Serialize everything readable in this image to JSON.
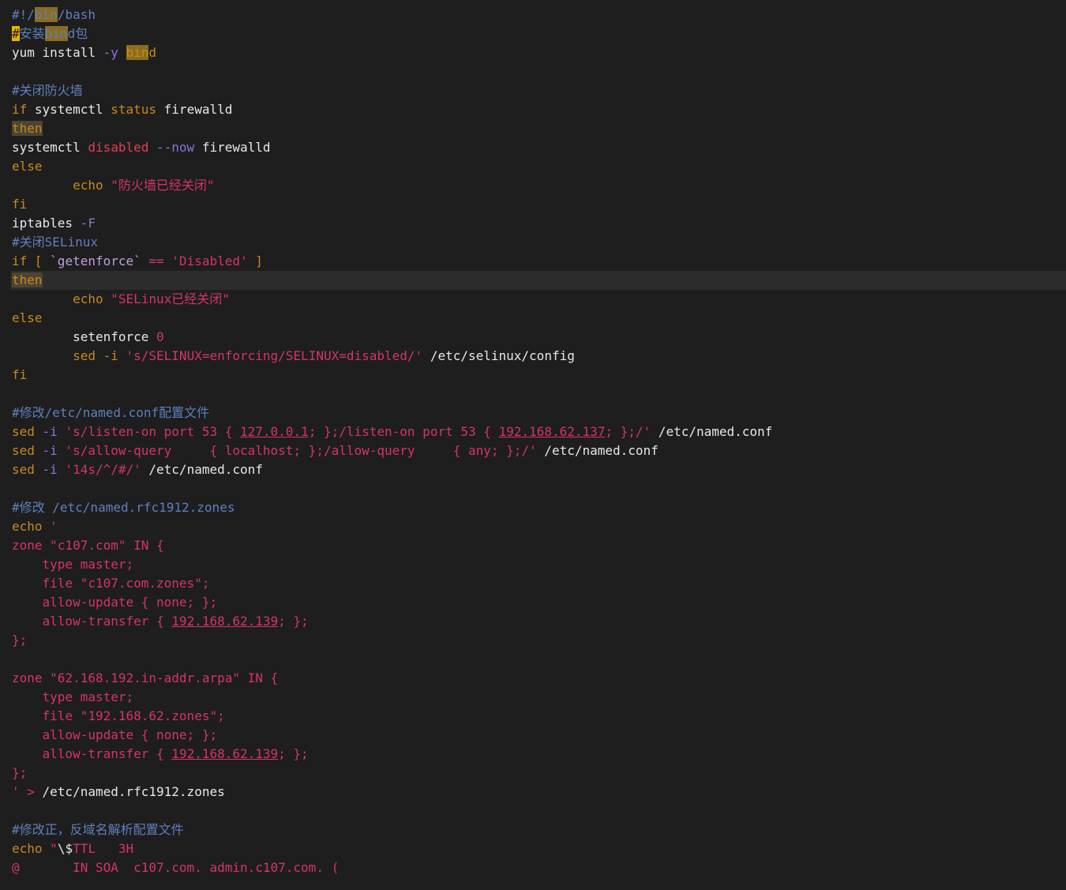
{
  "editor": {
    "current_line_index": 14,
    "colors": {
      "background": "#1e1e1e",
      "comment": "#5f7fbf",
      "keyword": "#c8891c",
      "string": "#d6336c",
      "search_highlight": "#8a6d1e"
    },
    "lines": [
      [
        {
          "t": "#!/",
          "c": "com"
        },
        {
          "t": "bin",
          "c": "com",
          "h": "hl"
        },
        {
          "t": "/bash",
          "c": "com"
        }
      ],
      [
        {
          "t": "#",
          "c": "com",
          "h": "cursor"
        },
        {
          "t": "安装",
          "c": "com"
        },
        {
          "t": "bin",
          "c": "com",
          "h": "hl"
        },
        {
          "t": "d包",
          "c": "com"
        }
      ],
      [
        {
          "t": "yum install ",
          "c": "cmd"
        },
        {
          "t": "-y",
          "c": "opt"
        },
        {
          "t": " ",
          "c": "cmd"
        },
        {
          "t": "bin",
          "c": "kw",
          "h": "hl"
        },
        {
          "t": "d",
          "c": "kw"
        }
      ],
      [],
      [
        {
          "t": "#关闭防火墙",
          "c": "com"
        }
      ],
      [
        {
          "t": "if",
          "c": "kw"
        },
        {
          "t": " systemctl ",
          "c": "cmd"
        },
        {
          "t": "status",
          "c": "kw"
        },
        {
          "t": " firewalld",
          "c": "cmd"
        }
      ],
      [
        {
          "t": "then",
          "c": "kw",
          "h": "hl2"
        }
      ],
      [
        {
          "t": "systemctl ",
          "c": "cmd"
        },
        {
          "t": "disabled",
          "c": "red"
        },
        {
          "t": " --now",
          "c": "opt"
        },
        {
          "t": " firewalld",
          "c": "cmd"
        }
      ],
      [
        {
          "t": "else",
          "c": "kw"
        }
      ],
      [
        {
          "t": "        echo ",
          "c": "kw"
        },
        {
          "t": "\"防火墙已经关闭\"",
          "c": "str"
        }
      ],
      [
        {
          "t": "fi",
          "c": "kw"
        }
      ],
      [
        {
          "t": "iptables ",
          "c": "cmd"
        },
        {
          "t": "-F",
          "c": "opt"
        }
      ],
      [
        {
          "t": "#关闭SELinux",
          "c": "com"
        }
      ],
      [
        {
          "t": "if [ ",
          "c": "kw"
        },
        {
          "t": "`getenforce`",
          "c": "cmdsub"
        },
        {
          "t": " == ",
          "c": "op"
        },
        {
          "t": "'Disabled'",
          "c": "str"
        },
        {
          "t": " ]",
          "c": "kw"
        }
      ],
      [
        {
          "t": "then",
          "c": "kw",
          "h": "hl2"
        }
      ],
      [
        {
          "t": "        echo ",
          "c": "kw"
        },
        {
          "t": "\"SELinux已经关闭\"",
          "c": "str"
        }
      ],
      [
        {
          "t": "else",
          "c": "kw"
        }
      ],
      [
        {
          "t": "        setenforce ",
          "c": "cmd"
        },
        {
          "t": "0",
          "c": "num"
        }
      ],
      [
        {
          "t": "        sed -i ",
          "c": "kw"
        },
        {
          "t": "'s/SELINUX=enforcing/SELINUX=disabled/'",
          "c": "str"
        },
        {
          "t": " /etc/selinux/config",
          "c": "cmd"
        }
      ],
      [
        {
          "t": "fi",
          "c": "kw"
        }
      ],
      [],
      [
        {
          "t": "#修改/etc/named.conf配置文件",
          "c": "com"
        }
      ],
      [
        {
          "t": "sed ",
          "c": "kw"
        },
        {
          "t": "-i",
          "c": "opt"
        },
        {
          "t": " 's/listen-on port 53 { ",
          "c": "str"
        },
        {
          "t": "127.0.0.1",
          "c": "str",
          "h": "ul"
        },
        {
          "t": "; };/listen-on port 53 { ",
          "c": "str"
        },
        {
          "t": "192.168.62.137",
          "c": "str",
          "h": "ul"
        },
        {
          "t": "; };/'",
          "c": "str"
        },
        {
          "t": " /etc/named.conf",
          "c": "cmd"
        }
      ],
      [
        {
          "t": "sed ",
          "c": "kw"
        },
        {
          "t": "-i",
          "c": "opt"
        },
        {
          "t": " 's/allow-query     { localhost; };/allow-query     { any; };/'",
          "c": "str"
        },
        {
          "t": " /etc/named.conf",
          "c": "cmd"
        }
      ],
      [
        {
          "t": "sed ",
          "c": "kw"
        },
        {
          "t": "-i",
          "c": "opt"
        },
        {
          "t": " '14s/^/#/'",
          "c": "str"
        },
        {
          "t": " /etc/named.conf",
          "c": "cmd"
        }
      ],
      [],
      [
        {
          "t": "#修改 /etc/named.rfc1912.zones",
          "c": "com"
        }
      ],
      [
        {
          "t": "echo ",
          "c": "kw"
        },
        {
          "t": "'",
          "c": "str"
        }
      ],
      [
        {
          "t": "zone \"c107.com\" IN {",
          "c": "str"
        }
      ],
      [
        {
          "t": "    type master;",
          "c": "str"
        }
      ],
      [
        {
          "t": "    file \"c107.com.zones\";",
          "c": "str"
        }
      ],
      [
        {
          "t": "    allow-update { none; };",
          "c": "str"
        }
      ],
      [
        {
          "t": "    allow-transfer { ",
          "c": "str"
        },
        {
          "t": "192.168.62.139",
          "c": "str",
          "h": "ul"
        },
        {
          "t": "; };",
          "c": "str"
        }
      ],
      [
        {
          "t": "};",
          "c": "str"
        }
      ],
      [],
      [
        {
          "t": "zone \"62.168.192.in-addr.arpa\" IN {",
          "c": "str"
        }
      ],
      [
        {
          "t": "    type master;",
          "c": "str"
        }
      ],
      [
        {
          "t": "    file \"192.168.62.zones\";",
          "c": "str"
        }
      ],
      [
        {
          "t": "    allow-update { none; };",
          "c": "str"
        }
      ],
      [
        {
          "t": "    allow-transfer { ",
          "c": "str"
        },
        {
          "t": "192.168.62.139",
          "c": "str",
          "h": "ul"
        },
        {
          "t": "; };",
          "c": "str"
        }
      ],
      [
        {
          "t": "};",
          "c": "str"
        }
      ],
      [
        {
          "t": "' > ",
          "c": "str"
        },
        {
          "t": "/etc/named.rfc1912.zones",
          "c": "cmd"
        }
      ],
      [],
      [
        {
          "t": "#修改正，反域名解析配置文件",
          "c": "com"
        }
      ],
      [
        {
          "t": "echo ",
          "c": "kw"
        },
        {
          "t": "\"",
          "c": "str"
        },
        {
          "t": "\\$",
          "c": "cmd"
        },
        {
          "t": "TTL   3H",
          "c": "str"
        }
      ],
      [
        {
          "t": "@       IN SOA  c107.com. admin.c107.com. (",
          "c": "str"
        }
      ]
    ]
  }
}
